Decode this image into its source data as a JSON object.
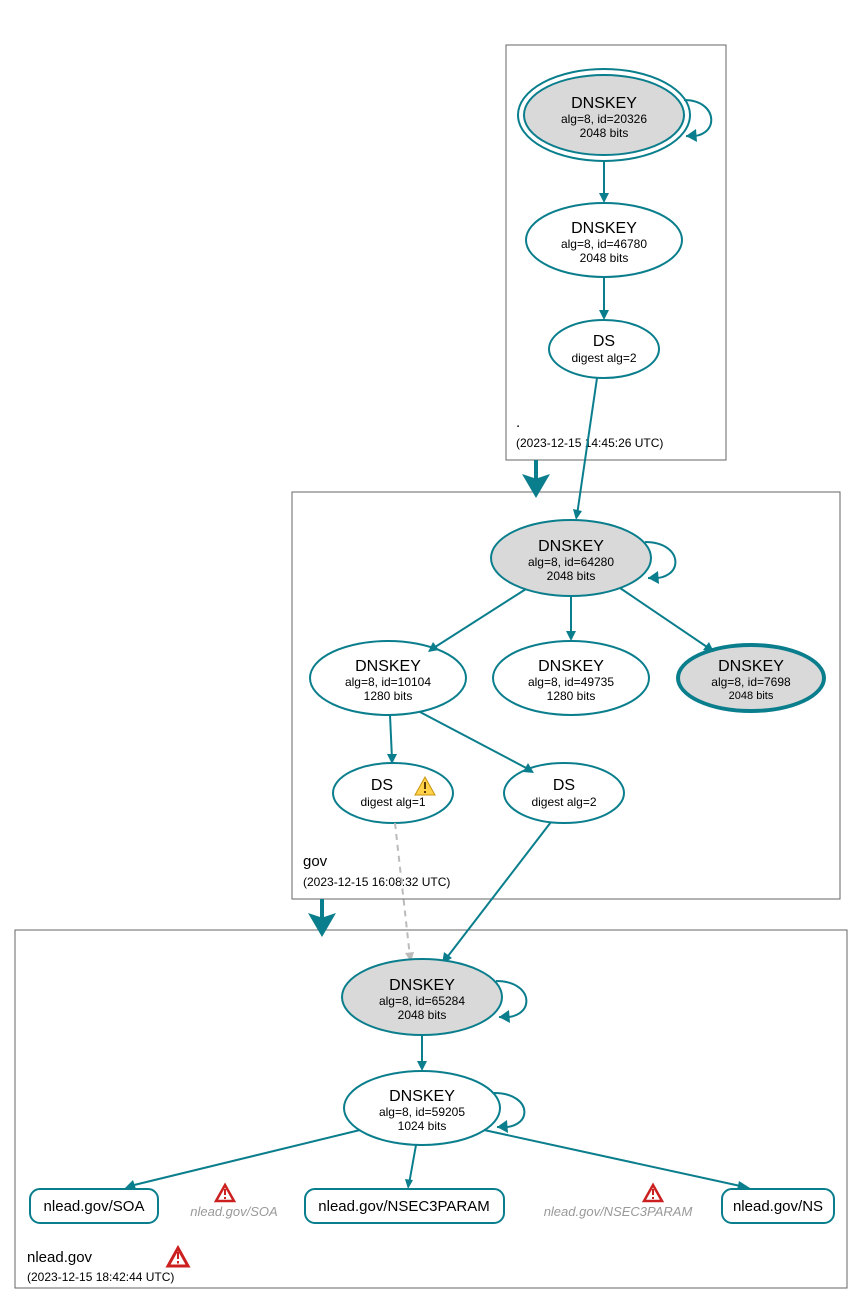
{
  "zones": {
    "root": {
      "name": ".",
      "timestamp": "(2023-12-15 14:45:26 UTC)"
    },
    "gov": {
      "name": "gov",
      "timestamp": "(2023-12-15 16:08:32 UTC)"
    },
    "nlead": {
      "name": "nlead.gov",
      "timestamp": "(2023-12-15 18:42:44 UTC)"
    }
  },
  "nodes": {
    "root_ksk": {
      "title": "DNSKEY",
      "l2": "alg=8, id=20326",
      "l3": "2048 bits"
    },
    "root_zsk": {
      "title": "DNSKEY",
      "l2": "alg=8, id=46780",
      "l3": "2048 bits"
    },
    "root_ds": {
      "title": "DS",
      "l2": "digest alg=2"
    },
    "gov_ksk": {
      "title": "DNSKEY",
      "l2": "alg=8, id=64280",
      "l3": "2048 bits"
    },
    "gov_zsk1": {
      "title": "DNSKEY",
      "l2": "alg=8, id=10104",
      "l3": "1280 bits"
    },
    "gov_zsk2": {
      "title": "DNSKEY",
      "l2": "alg=8, id=49735",
      "l3": "1280 bits"
    },
    "gov_extra": {
      "title": "DNSKEY",
      "l2": "alg=8, id=7698",
      "l3": "2048 bits"
    },
    "gov_ds1": {
      "title": "DS",
      "l2": "digest alg=1"
    },
    "gov_ds2": {
      "title": "DS",
      "l2": "digest alg=2"
    },
    "nlead_ksk": {
      "title": "DNSKEY",
      "l2": "alg=8, id=65284",
      "l3": "2048 bits"
    },
    "nlead_zsk": {
      "title": "DNSKEY",
      "l2": "alg=8, id=59205",
      "l3": "1024 bits"
    },
    "rr_soa": {
      "label": "nlead.gov/SOA"
    },
    "rr_nsec": {
      "label": "nlead.gov/NSEC3PARAM"
    },
    "rr_ns": {
      "label": "nlead.gov/NS"
    },
    "ph_soa": {
      "label": "nlead.gov/SOA"
    },
    "ph_nsec": {
      "label": "nlead.gov/NSEC3PARAM"
    }
  }
}
